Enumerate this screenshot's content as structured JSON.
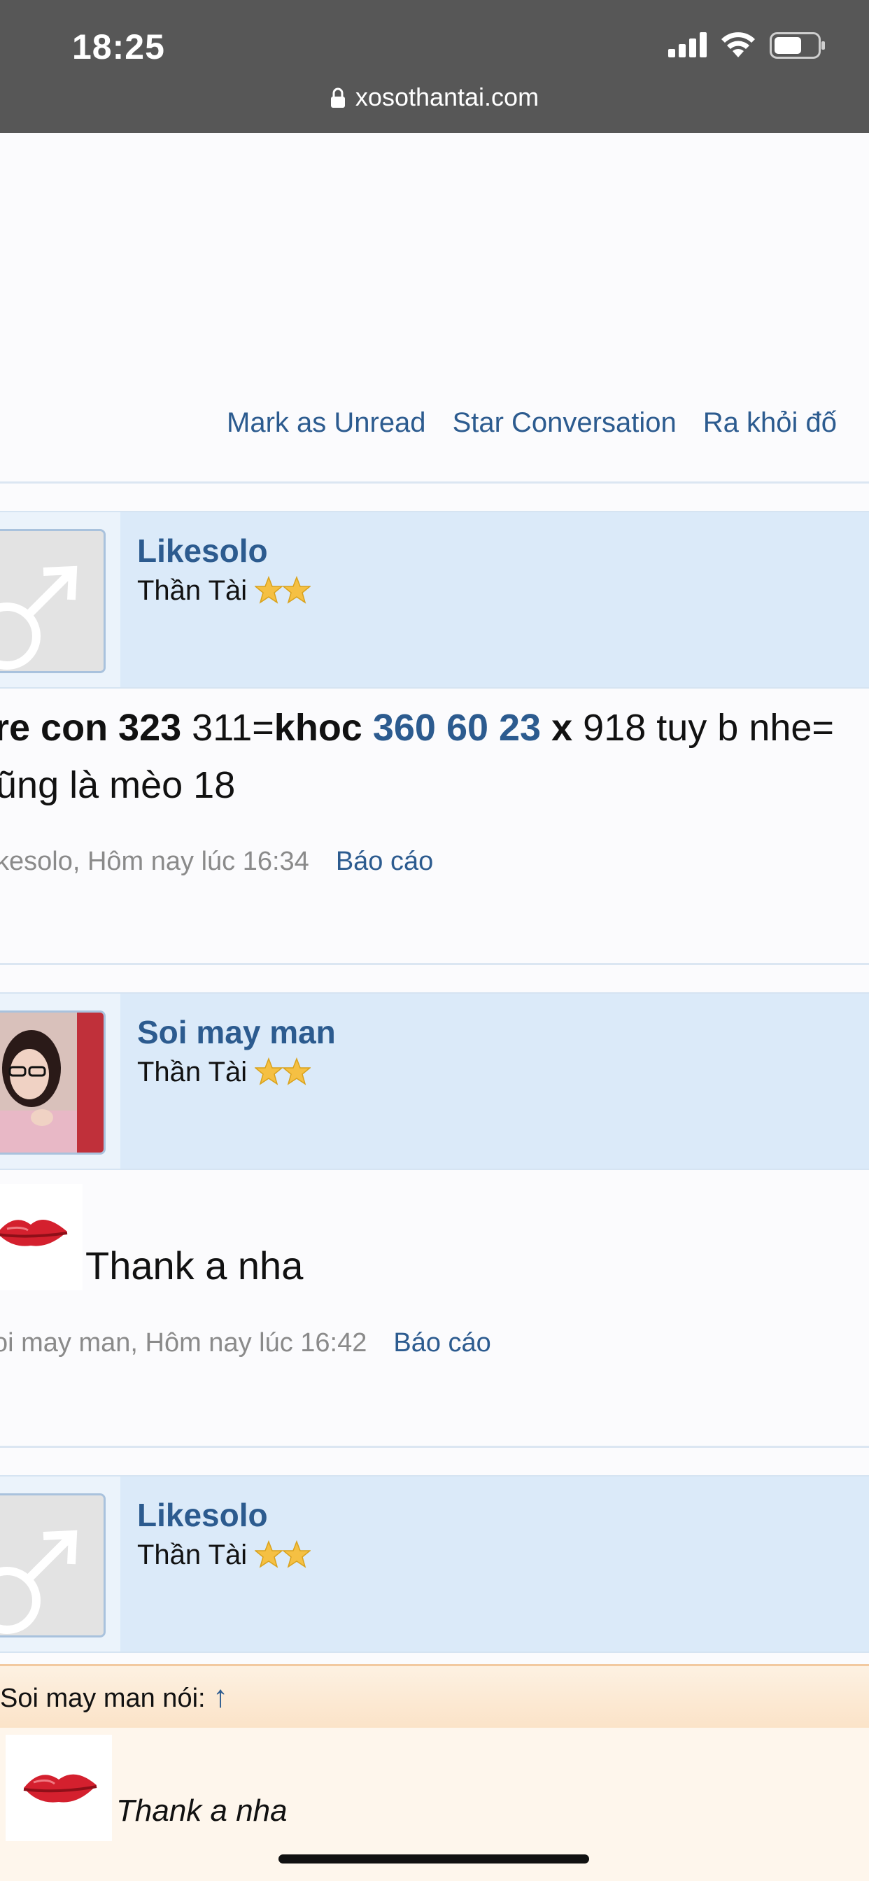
{
  "status_bar": {
    "time": "18:25",
    "url": "xosothantai.com"
  },
  "conversation_tools": {
    "mark_unread": "Mark as Unread",
    "star": "Star Conversation",
    "leave": "Ra khỏi đố"
  },
  "posts": [
    {
      "username": "Likesolo",
      "user_title": "Thần Tài",
      "message_line1": [
        {
          "text": "re con 323",
          "style": "bold"
        },
        {
          "text": " 311=",
          "style": "normal"
        },
        {
          "text": "khoc",
          "style": "bold"
        },
        {
          "text": " ",
          "style": "normal"
        },
        {
          "text": "360 60 23",
          "style": "blue"
        },
        {
          "text": " ",
          "style": "normal"
        },
        {
          "text": "x",
          "style": "bold"
        },
        {
          "text": " 918 tuy b nhe=",
          "style": "normal"
        }
      ],
      "message_line2": "ũng là mèo 18",
      "meta": "kesolo, Hôm nay lúc 16:34",
      "report": "Báo cáo"
    },
    {
      "username": "Soi may man",
      "user_title": "Thần Tài",
      "message": "Thank a nha",
      "meta": "oi may man, Hôm nay lúc 16:42",
      "report": "Báo cáo"
    },
    {
      "username": "Likesolo",
      "user_title": "Thần Tài",
      "quote_header": "Soi may man nói:",
      "quote_arrow": "↑",
      "quote_text": "Thank a nha"
    }
  ],
  "icons": [
    "lock-icon",
    "signal-icon",
    "wifi-icon",
    "battery-icon",
    "male-avatar-icon",
    "star-icon",
    "kiss-emoji-icon"
  ]
}
